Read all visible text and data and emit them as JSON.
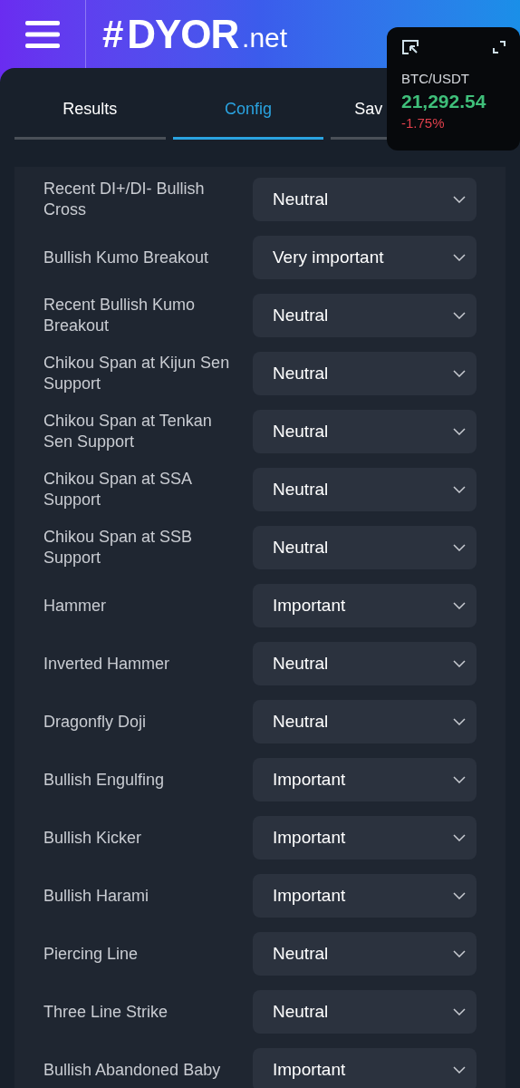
{
  "header": {
    "logo_hash": "#",
    "logo_main": "DYOR",
    "logo_suffix": ".net"
  },
  "tabs": [
    {
      "label": "Results",
      "selected": false
    },
    {
      "label": "Config",
      "selected": true
    },
    {
      "label": "Sav",
      "selected": false
    }
  ],
  "ticker": {
    "pair": "BTC/USDT",
    "price": "21,292.54",
    "change": "-1.75%"
  },
  "settings": [
    {
      "label": "Recent DI+/DI- Bullish Cross",
      "value": "Neutral"
    },
    {
      "label": "Bullish Kumo Breakout",
      "value": "Very important"
    },
    {
      "label": "Recent Bullish Kumo Breakout",
      "value": "Neutral"
    },
    {
      "label": "Chikou Span at Kijun Sen Support",
      "value": "Neutral"
    },
    {
      "label": "Chikou Span at Tenkan Sen Support",
      "value": "Neutral"
    },
    {
      "label": "Chikou Span at SSA Support",
      "value": "Neutral"
    },
    {
      "label": "Chikou Span at SSB Support",
      "value": "Neutral"
    },
    {
      "label": "Hammer",
      "value": "Important"
    },
    {
      "label": "Inverted Hammer",
      "value": "Neutral"
    },
    {
      "label": "Dragonfly Doji",
      "value": "Neutral"
    },
    {
      "label": "Bullish Engulfing",
      "value": "Important"
    },
    {
      "label": "Bullish Kicker",
      "value": "Important"
    },
    {
      "label": "Bullish Harami",
      "value": "Important"
    },
    {
      "label": "Piercing Line",
      "value": "Neutral"
    },
    {
      "label": "Three Line Strike",
      "value": "Neutral"
    },
    {
      "label": "Bullish Abandoned Baby",
      "value": "Important"
    }
  ]
}
